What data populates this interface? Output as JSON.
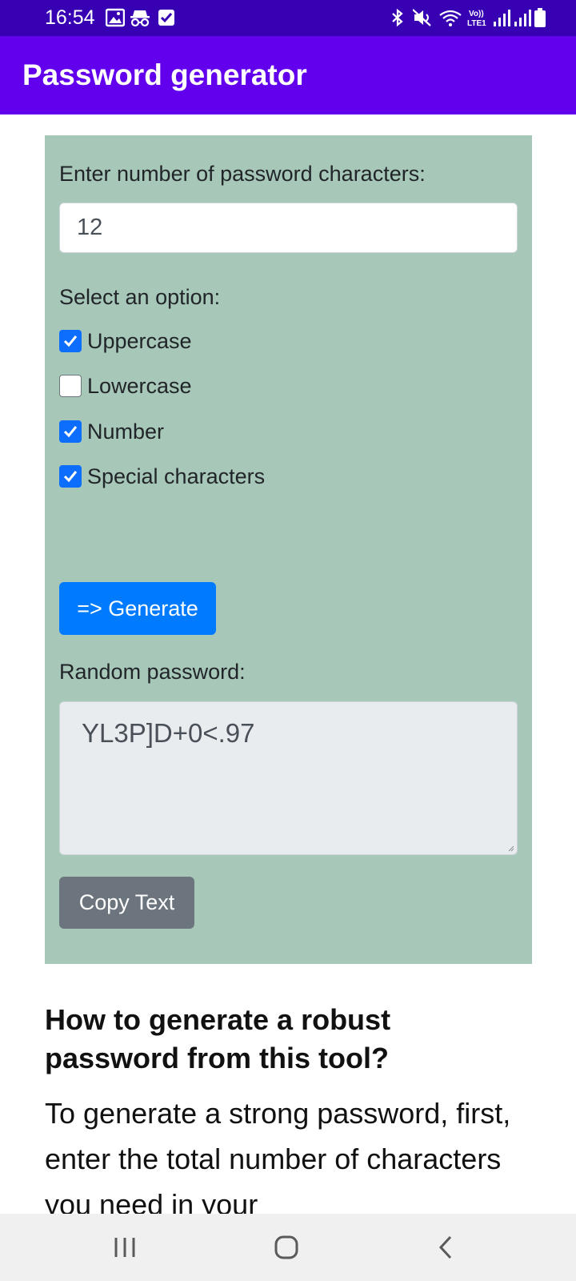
{
  "status_bar": {
    "time": "16:54",
    "left_icons": [
      "image-icon",
      "incognito-icon",
      "checkbox-icon"
    ],
    "right_icons": [
      "bluetooth-icon",
      "mute-icon",
      "wifi-icon",
      "volte-icon",
      "signal-icon",
      "signal-icon",
      "battery-icon"
    ]
  },
  "app_bar": {
    "title": "Password generator"
  },
  "form": {
    "length_label": "Enter number of password characters:",
    "length_value": "12",
    "options_label": "Select an option:",
    "options": [
      {
        "label": "Uppercase",
        "checked": true
      },
      {
        "label": "Lowercase",
        "checked": false
      },
      {
        "label": "Number",
        "checked": true
      },
      {
        "label": "Special characters",
        "checked": true
      }
    ],
    "generate_label": "=> Generate",
    "result_label": "Random password:",
    "password": "YL3P]D+0<.97",
    "copy_label": "Copy Text"
  },
  "article": {
    "heading": "How to generate a robust password from this tool?",
    "body": "To generate a strong password, first, enter the total number of characters you need in your"
  },
  "colors": {
    "status_bar": "#3700b3",
    "app_bar": "#6200ee",
    "card": "#a7c8b8",
    "primary_button": "#007bff",
    "secondary_button": "#6c757d",
    "checkbox_checked": "#0d6efd"
  },
  "nav_bar": {
    "buttons": [
      "recent-apps-icon",
      "home-icon",
      "back-icon"
    ]
  }
}
